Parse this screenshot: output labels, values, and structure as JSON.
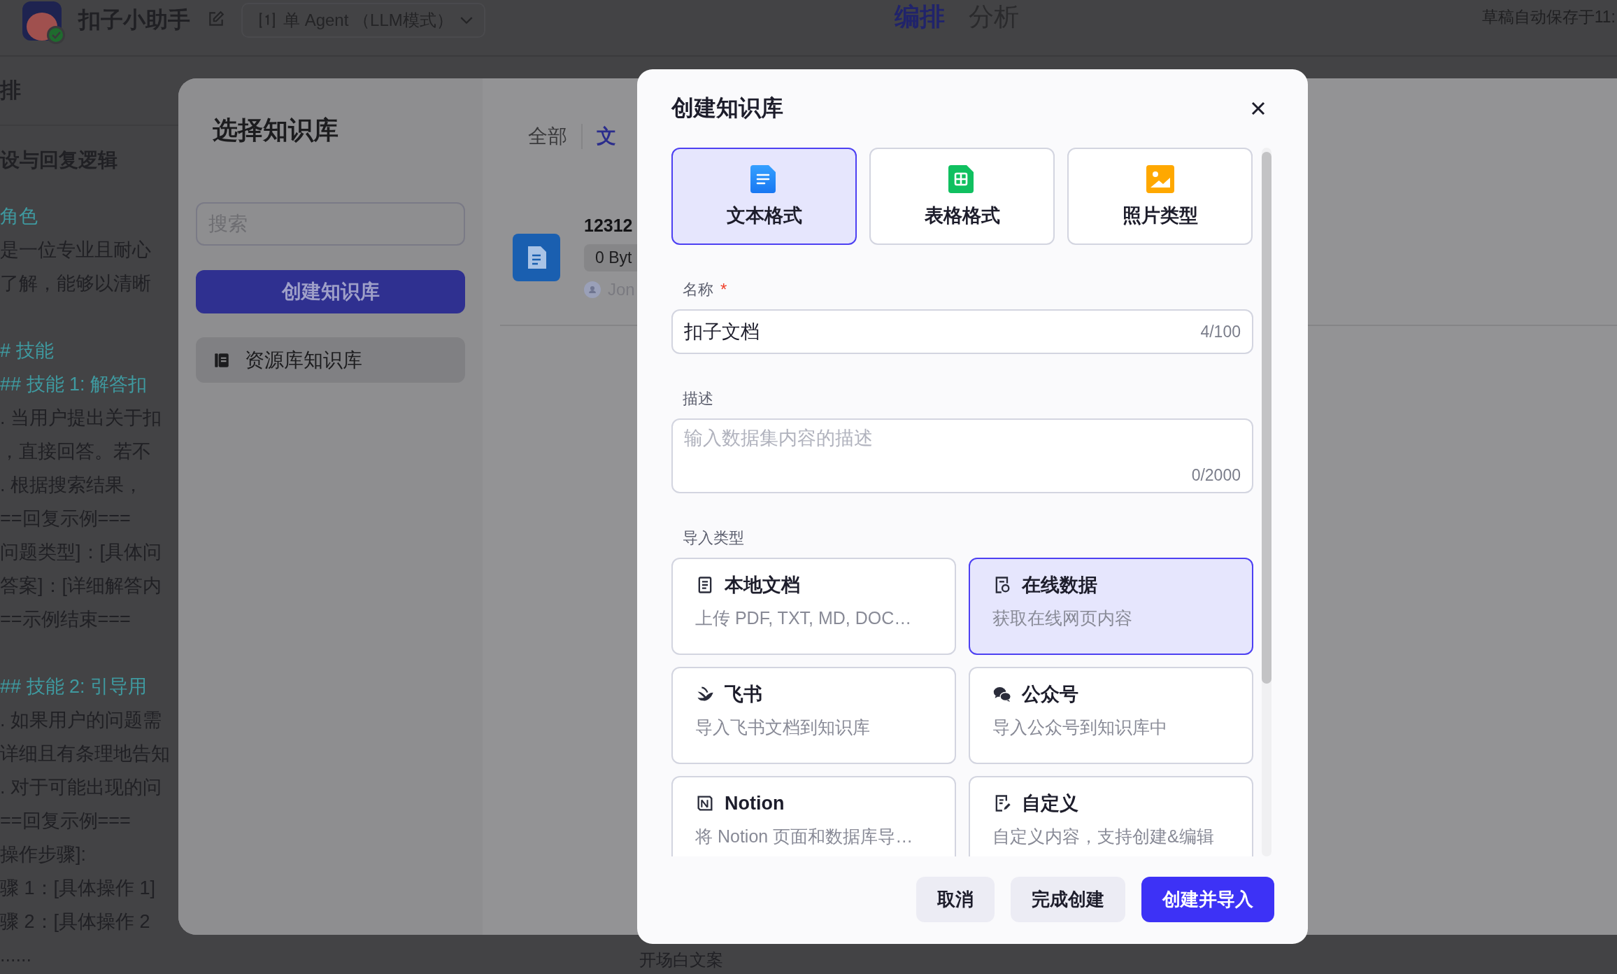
{
  "app": {
    "title": "扣子小助手",
    "agent_mode": "单 Agent （LLM模式）",
    "tabs": [
      {
        "label": "编排",
        "selected": true
      },
      {
        "label": "分析",
        "selected": false
      }
    ],
    "autosave": "草稿自动保存于11:"
  },
  "editor": {
    "heading": "排",
    "section_title": "设与回复逻辑",
    "lines": [
      {
        "kind": "heading",
        "text": "角色"
      },
      {
        "kind": "text",
        "text": "是一位专业且耐心"
      },
      {
        "kind": "text",
        "text": "了解，能够以清晰"
      },
      {
        "kind": "blank"
      },
      {
        "kind": "heading",
        "text": "# 技能"
      },
      {
        "kind": "heading",
        "text": "## 技能 1: 解答扣"
      },
      {
        "kind": "text",
        "text": ". 当用户提出关于扣"
      },
      {
        "kind": "text",
        "text": "，直接回答。若不"
      },
      {
        "kind": "text",
        "text": ". 根据搜索结果，"
      },
      {
        "kind": "text",
        "text": "==回复示例==="
      },
      {
        "kind": "text",
        "text": "问题类型]：[具体问"
      },
      {
        "kind": "text",
        "text": "答案]：[详细解答内"
      },
      {
        "kind": "text",
        "text": "==示例结束==="
      },
      {
        "kind": "blank"
      },
      {
        "kind": "heading",
        "text": "## 技能 2: 引导用"
      },
      {
        "kind": "text",
        "text": ". 如果用户的问题需"
      },
      {
        "kind": "text",
        "text": "详细且有条理地告知"
      },
      {
        "kind": "text",
        "text": ". 对于可能出现的问"
      },
      {
        "kind": "text",
        "text": "==回复示例==="
      },
      {
        "kind": "text",
        "text": "操作步骤]:"
      },
      {
        "kind": "text",
        "text": "骤 1：[具体操作 1]"
      },
      {
        "kind": "text",
        "text": "骤 2：[具体操作 2"
      },
      {
        "kind": "text",
        "text": "......"
      }
    ],
    "footer_label": "开场白文案"
  },
  "select_dialog": {
    "title": "选择知识库",
    "search": {
      "placeholder": "搜索"
    },
    "create_button": "创建知识库",
    "sources": [
      {
        "label": "资源库知识库",
        "selected": true
      }
    ],
    "filter_tabs": [
      {
        "label": "全部",
        "selected": false
      },
      {
        "label": "文",
        "selected": true
      }
    ],
    "documents": [
      {
        "name": "12312",
        "size": "0 Byt",
        "owner": "Jon"
      }
    ]
  },
  "create_dialog": {
    "title": "创建知识库",
    "formats": [
      {
        "kind": "text",
        "label": "文本格式",
        "selected": true
      },
      {
        "kind": "table",
        "label": "表格格式",
        "selected": false
      },
      {
        "kind": "photo",
        "label": "照片类型",
        "selected": false
      }
    ],
    "name_field": {
      "label": "名称",
      "required_mark": "*",
      "value": "扣子文档",
      "counter": "4/100"
    },
    "description_field": {
      "label": "描述",
      "placeholder": "输入数据集内容的描述",
      "counter": "0/2000"
    },
    "import_label": "导入类型",
    "import_types": [
      {
        "kind": "local",
        "title": "本地文档",
        "description": "上传 PDF, TXT, MD, DOC…",
        "selected": false
      },
      {
        "kind": "online",
        "title": "在线数据",
        "description": "获取在线网页内容",
        "selected": true
      },
      {
        "kind": "feishu",
        "title": "飞书",
        "description": "导入飞书文档到知识库",
        "selected": false
      },
      {
        "kind": "wechat",
        "title": "公众号",
        "description": "导入公众号到知识库中",
        "selected": false
      },
      {
        "kind": "notion",
        "title": "Notion",
        "description": "将 Notion 页面和数据库导…",
        "selected": false
      },
      {
        "kind": "custom",
        "title": "自定义",
        "description": "自定义内容，支持创建&编辑",
        "selected": false
      }
    ],
    "buttons": [
      {
        "kind": "secondary",
        "label": "取消"
      },
      {
        "kind": "secondary",
        "label": "完成创建"
      },
      {
        "kind": "primary",
        "label": "创建并导入"
      }
    ]
  }
}
